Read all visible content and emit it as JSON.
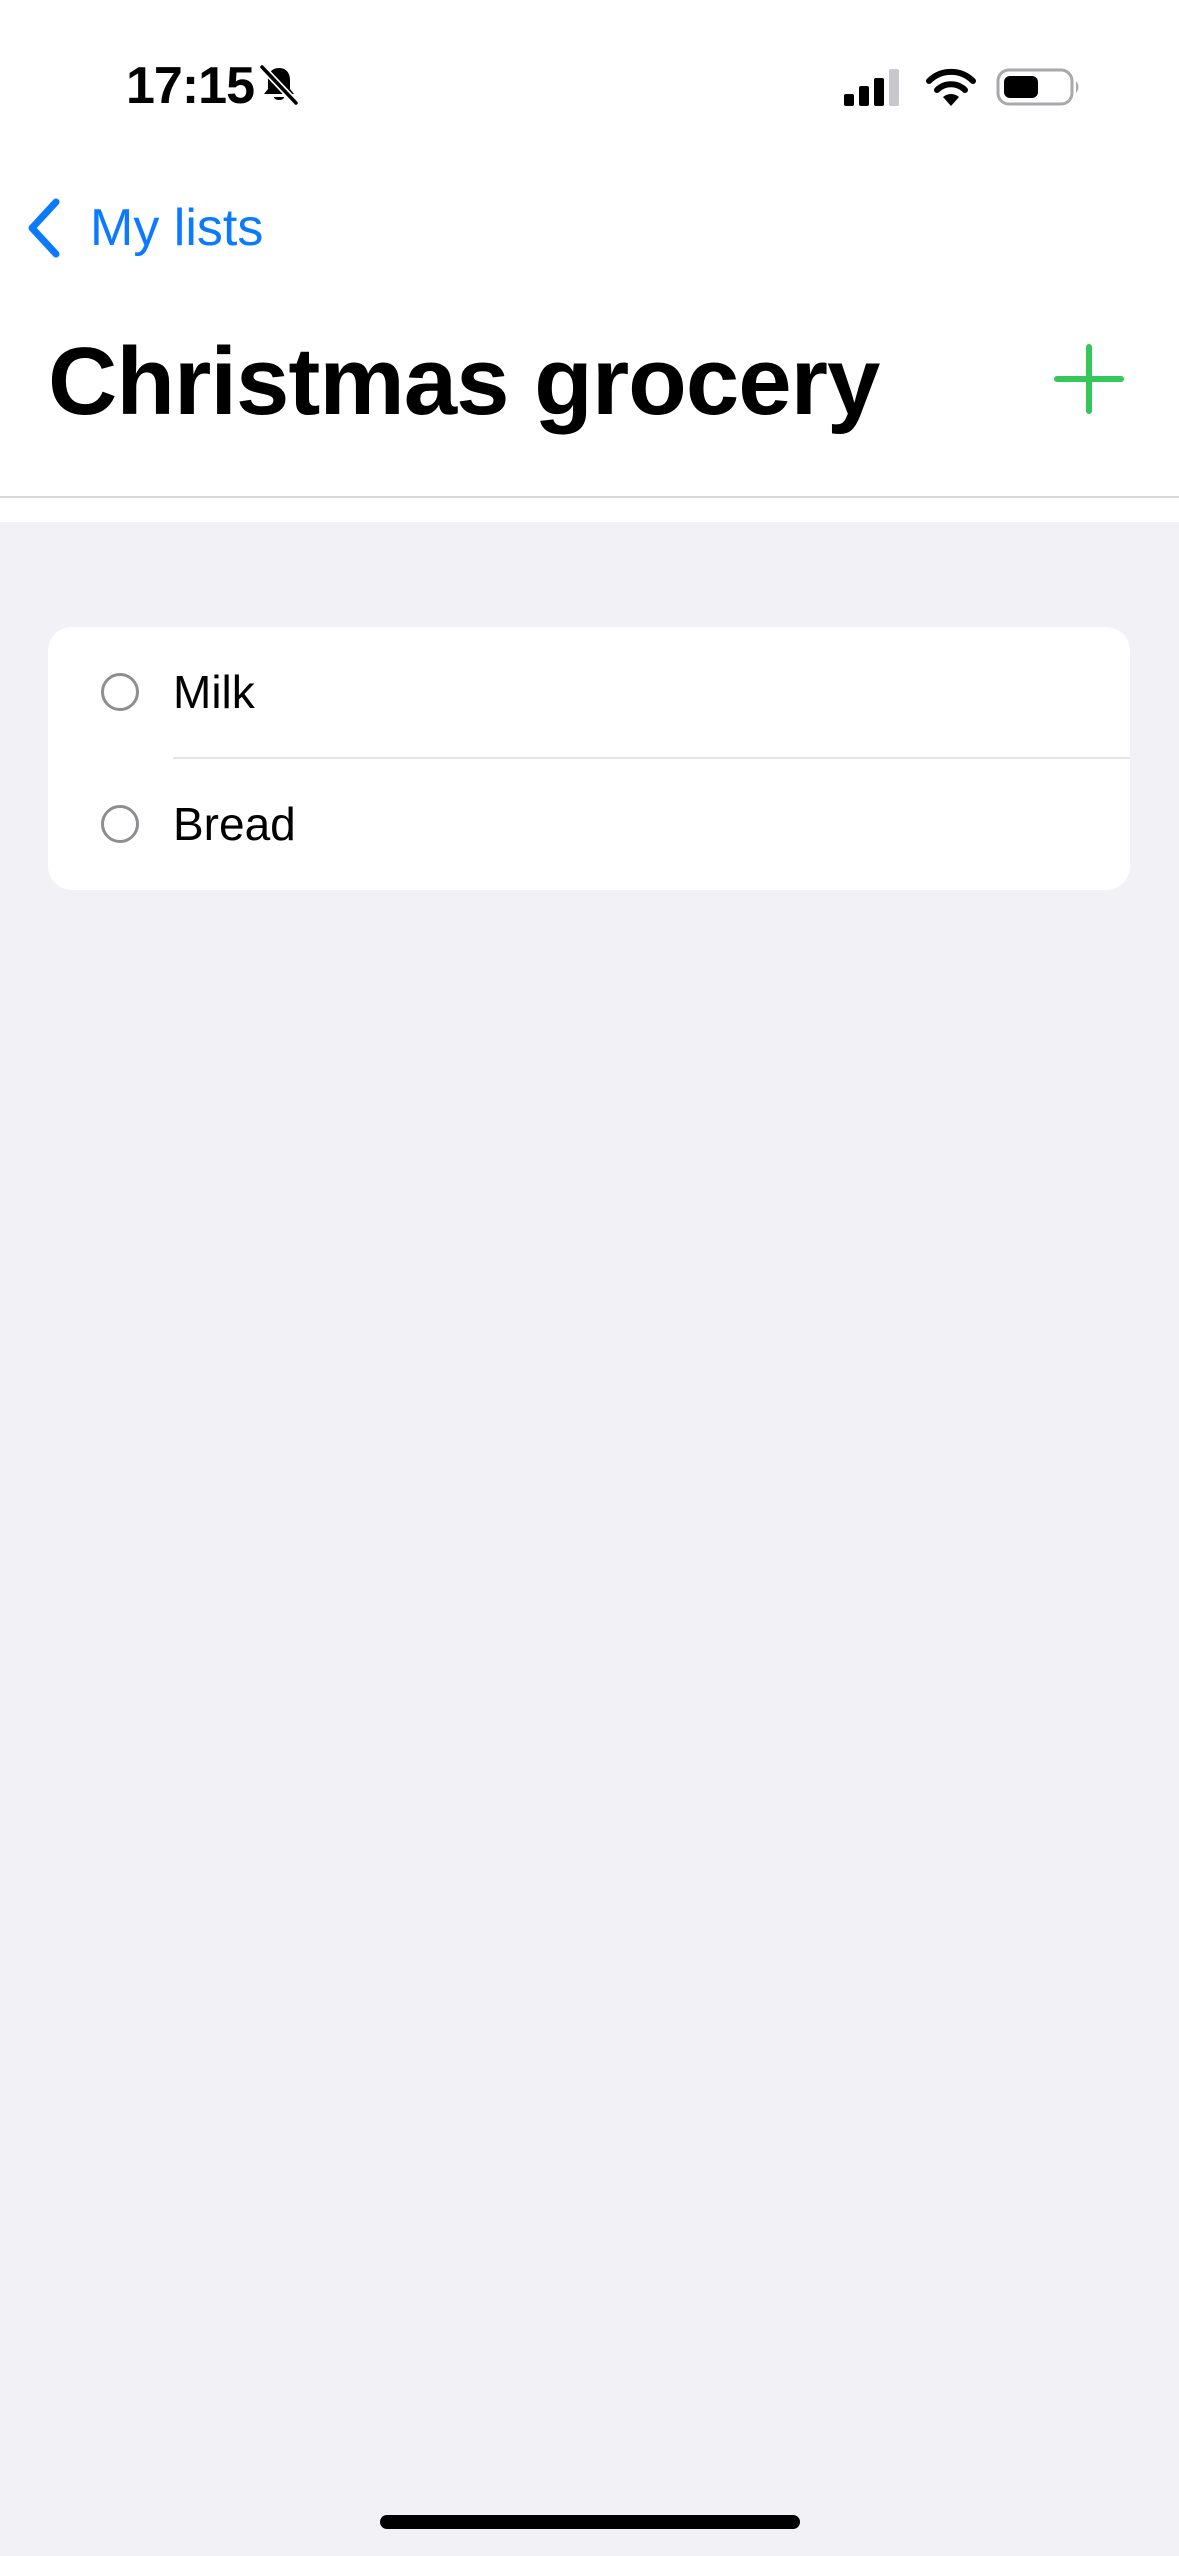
{
  "status_bar": {
    "time": "17:15",
    "icons": [
      "bell-slash-icon",
      "cellular-signal-icon",
      "wifi-icon",
      "battery-icon"
    ]
  },
  "nav": {
    "back_label": "My lists",
    "back_icon": "chevron-left-icon",
    "title": "Christmas grocery",
    "add_icon": "plus-icon"
  },
  "list": {
    "items": [
      {
        "label": "Milk",
        "checked": false
      },
      {
        "label": "Bread",
        "checked": false
      }
    ]
  },
  "colors": {
    "accent_blue": "#0b7aff",
    "add_green": "#34c759",
    "background": "#f2f1f6"
  }
}
